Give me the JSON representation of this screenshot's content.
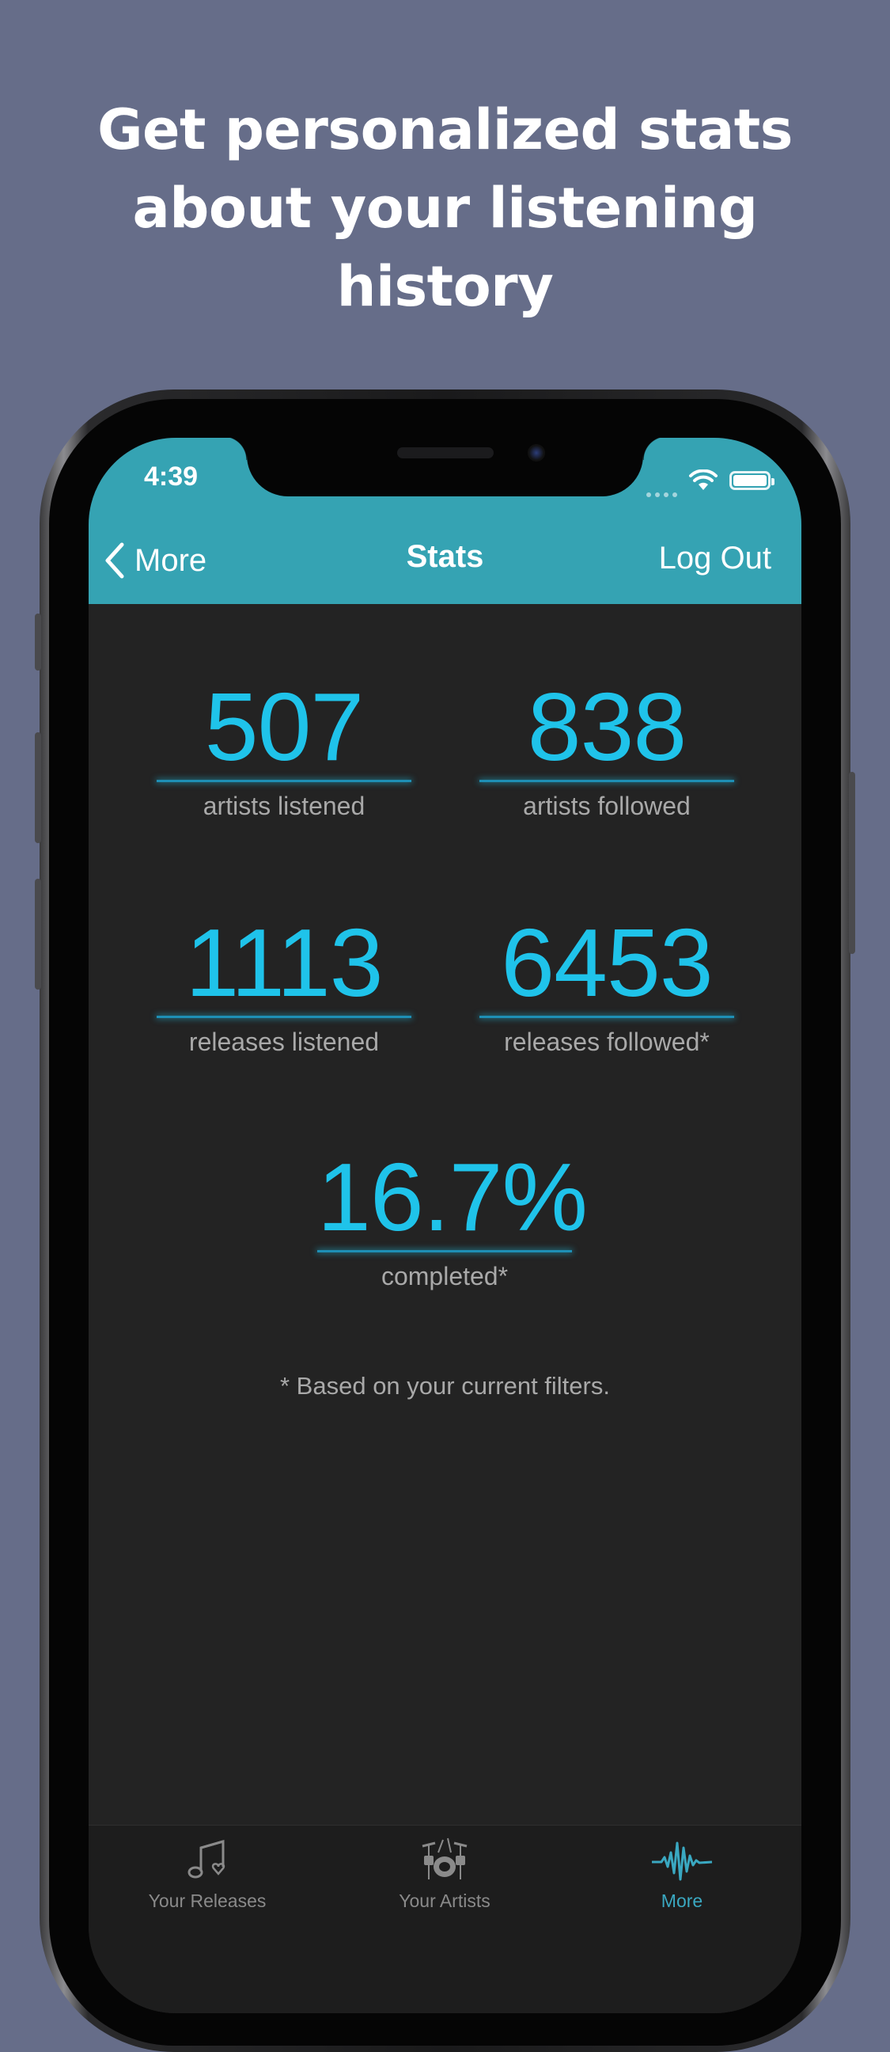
{
  "headline": [
    "Get personalized stats",
    "about your listening",
    "history"
  ],
  "status_bar": {
    "time": "4:39"
  },
  "nav": {
    "back_label": "More",
    "title": "Stats",
    "right_label": "Log Out"
  },
  "stats": [
    {
      "value": "507",
      "label": "artists listened"
    },
    {
      "value": "838",
      "label": "artists followed"
    },
    {
      "value": "1113",
      "label": "releases listened"
    },
    {
      "value": "6453",
      "label": "releases followed*"
    },
    {
      "value": "16.7%",
      "label": "completed*"
    }
  ],
  "footnote": "* Based on your current filters.",
  "tabs": [
    {
      "label": "Your Releases",
      "icon": "music-notes-icon",
      "active": false
    },
    {
      "label": "Your Artists",
      "icon": "drum-kit-icon",
      "active": false
    },
    {
      "label": "More",
      "icon": "waveform-icon",
      "active": true
    }
  ],
  "colors": {
    "background": "#666d89",
    "nav_bar": "#35a3b3",
    "stat_value": "#1fc3ea",
    "screen": "#232323",
    "tab_active": "#3aa8c1"
  }
}
